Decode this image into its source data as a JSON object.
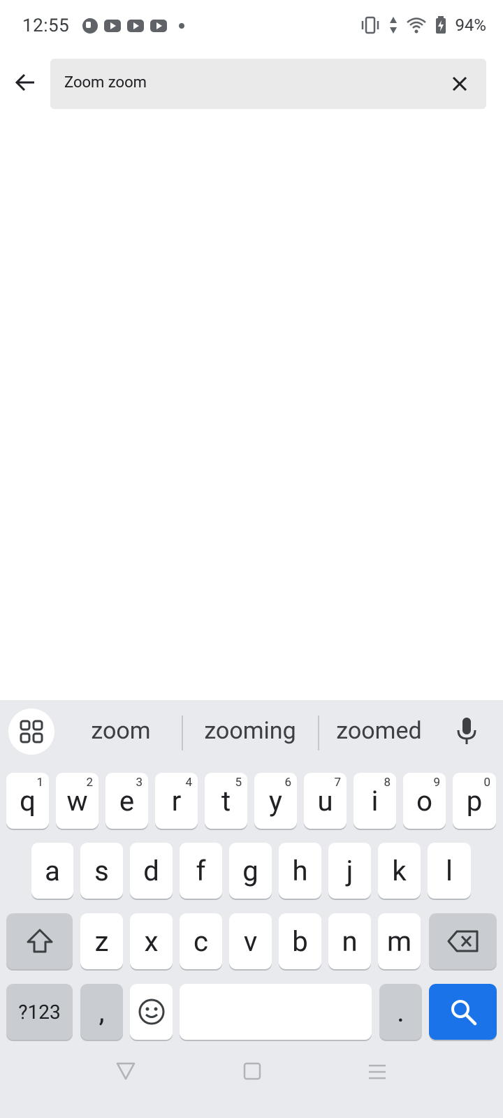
{
  "status_bar": {
    "time": "12:55",
    "battery": "94%"
  },
  "search": {
    "query": "Zoom zoom"
  },
  "keyboard": {
    "suggestions": [
      "zoom",
      "zooming",
      "zoomed"
    ],
    "row1": [
      {
        "key": "q",
        "hint": "1"
      },
      {
        "key": "w",
        "hint": "2"
      },
      {
        "key": "e",
        "hint": "3"
      },
      {
        "key": "r",
        "hint": "4"
      },
      {
        "key": "t",
        "hint": "5"
      },
      {
        "key": "y",
        "hint": "6"
      },
      {
        "key": "u",
        "hint": "7"
      },
      {
        "key": "i",
        "hint": "8"
      },
      {
        "key": "o",
        "hint": "9"
      },
      {
        "key": "p",
        "hint": "0"
      }
    ],
    "row2": [
      "a",
      "s",
      "d",
      "f",
      "g",
      "h",
      "j",
      "k",
      "l"
    ],
    "row3": [
      "z",
      "x",
      "c",
      "v",
      "b",
      "n",
      "m"
    ],
    "symbols_label": "?123",
    "comma": ",",
    "period": ".",
    "action_color": "#1a73e8"
  }
}
